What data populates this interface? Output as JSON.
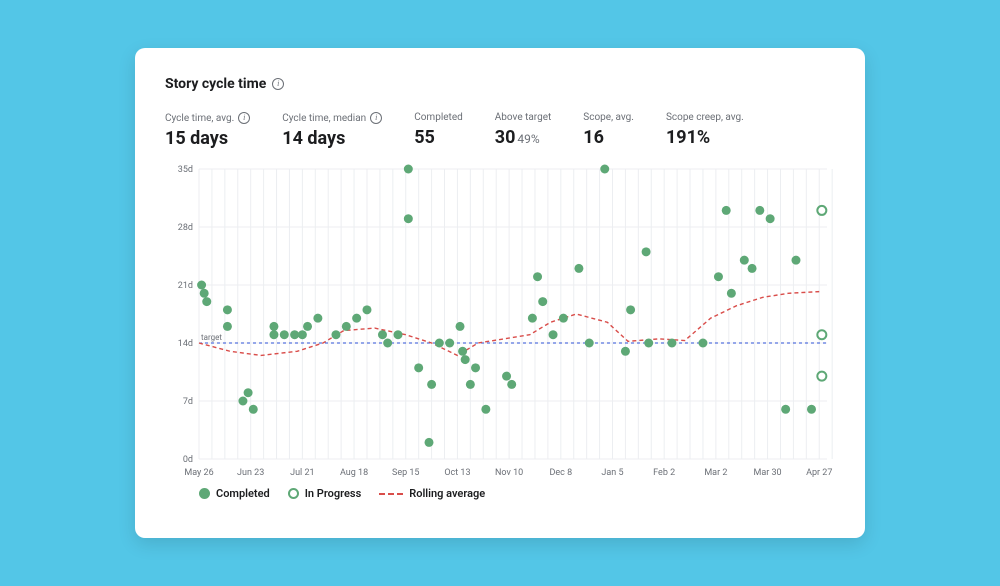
{
  "title": "Story cycle time",
  "metrics": [
    {
      "label": "Cycle time, avg.",
      "value": "15 days",
      "info": true
    },
    {
      "label": "Cycle time, median",
      "value": "14 days",
      "info": true
    },
    {
      "label": "Completed",
      "value": "55"
    },
    {
      "label": "Above target",
      "value": "30",
      "sub": "49%"
    },
    {
      "label": "Scope, avg.",
      "value": "16"
    },
    {
      "label": "Scope creep, avg.",
      "value": "191%"
    }
  ],
  "legend": {
    "completed": "Completed",
    "in_progress": "In Progress",
    "rolling": "Rolling average"
  },
  "chart_data": {
    "type": "scatter",
    "title": "Story cycle time",
    "xlabel": "",
    "ylabel": "",
    "ylim": [
      0,
      35
    ],
    "y_ticks": [
      0,
      7,
      14,
      21,
      28,
      35
    ],
    "y_tick_labels": [
      "0d",
      "7d",
      "14d",
      "21d",
      "28d",
      "35d"
    ],
    "x_categories": [
      "May 26",
      "Jun 23",
      "Jul 21",
      "Aug 18",
      "Sep 15",
      "Oct 13",
      "Nov 10",
      "Dec 8",
      "Jan 5",
      "Feb 2",
      "Mar 2",
      "Mar 30",
      "Apr 27"
    ],
    "target": 14,
    "target_label": "target",
    "series": [
      {
        "name": "Completed",
        "style": "solid",
        "points": [
          [
            0.05,
            21
          ],
          [
            0.1,
            20
          ],
          [
            0.15,
            19
          ],
          [
            0.55,
            18
          ],
          [
            0.55,
            16
          ],
          [
            0.85,
            7
          ],
          [
            0.95,
            8
          ],
          [
            1.05,
            6
          ],
          [
            1.45,
            16
          ],
          [
            1.45,
            15
          ],
          [
            1.65,
            15
          ],
          [
            1.85,
            15
          ],
          [
            2.0,
            15
          ],
          [
            2.1,
            16
          ],
          [
            2.3,
            17
          ],
          [
            2.65,
            15
          ],
          [
            2.85,
            16
          ],
          [
            3.05,
            17
          ],
          [
            3.25,
            18
          ],
          [
            3.55,
            15
          ],
          [
            3.65,
            14
          ],
          [
            3.85,
            15
          ],
          [
            4.05,
            35
          ],
          [
            4.05,
            29
          ],
          [
            4.25,
            11
          ],
          [
            4.45,
            2
          ],
          [
            4.5,
            9
          ],
          [
            4.65,
            14
          ],
          [
            4.85,
            14
          ],
          [
            5.05,
            16
          ],
          [
            5.1,
            13
          ],
          [
            5.15,
            12
          ],
          [
            5.25,
            9
          ],
          [
            5.35,
            11
          ],
          [
            5.55,
            6
          ],
          [
            5.95,
            10
          ],
          [
            6.05,
            9
          ],
          [
            6.45,
            17
          ],
          [
            6.55,
            22
          ],
          [
            6.65,
            19
          ],
          [
            6.85,
            15
          ],
          [
            7.05,
            17
          ],
          [
            7.35,
            23
          ],
          [
            7.55,
            14
          ],
          [
            7.85,
            35
          ],
          [
            8.25,
            13
          ],
          [
            8.35,
            18
          ],
          [
            8.65,
            25
          ],
          [
            8.7,
            14
          ],
          [
            9.15,
            14
          ],
          [
            9.75,
            14
          ],
          [
            10.05,
            22
          ],
          [
            10.2,
            30
          ],
          [
            10.3,
            20
          ],
          [
            10.55,
            24
          ],
          [
            10.7,
            23
          ],
          [
            10.85,
            30
          ],
          [
            11.05,
            29
          ],
          [
            11.35,
            6
          ],
          [
            11.55,
            24
          ],
          [
            11.85,
            6
          ]
        ]
      },
      {
        "name": "In Progress",
        "style": "open",
        "points": [
          [
            12.05,
            30
          ],
          [
            12.05,
            15
          ],
          [
            12.05,
            10
          ]
        ]
      },
      {
        "name": "Rolling average",
        "style": "dashed-line",
        "points": [
          [
            0.0,
            14
          ],
          [
            0.6,
            13
          ],
          [
            1.2,
            12.5
          ],
          [
            1.9,
            13
          ],
          [
            2.4,
            14
          ],
          [
            2.8,
            15.5
          ],
          [
            3.4,
            15.8
          ],
          [
            4.0,
            15
          ],
          [
            4.5,
            14
          ],
          [
            5.0,
            12.5
          ],
          [
            5.4,
            14
          ],
          [
            5.9,
            14.5
          ],
          [
            6.4,
            15
          ],
          [
            6.8,
            16.5
          ],
          [
            7.3,
            17.5
          ],
          [
            7.9,
            16.5
          ],
          [
            8.3,
            14.2
          ],
          [
            8.9,
            14.5
          ],
          [
            9.4,
            14.3
          ],
          [
            9.9,
            17
          ],
          [
            10.4,
            18.5
          ],
          [
            10.9,
            19.5
          ],
          [
            11.4,
            20
          ],
          [
            12.0,
            20.2
          ]
        ]
      }
    ]
  }
}
